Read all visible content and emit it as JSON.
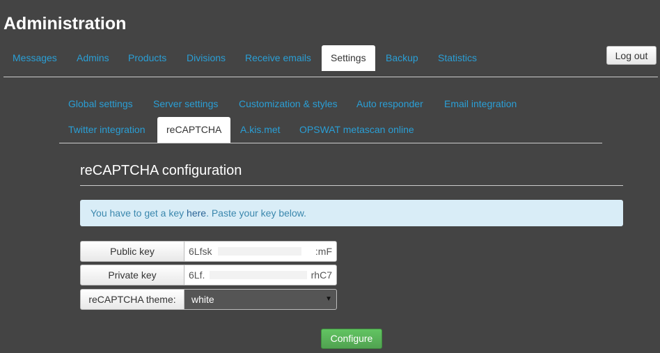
{
  "app": {
    "title": "Administration"
  },
  "main_nav": {
    "tabs": [
      {
        "label": "Messages"
      },
      {
        "label": "Admins"
      },
      {
        "label": "Products"
      },
      {
        "label": "Divisions"
      },
      {
        "label": "Receive emails"
      },
      {
        "label": "Settings",
        "active": true
      },
      {
        "label": "Backup"
      },
      {
        "label": "Statistics"
      }
    ],
    "logout_label": "Log out"
  },
  "settings_nav": {
    "tabs": [
      {
        "label": "Global settings"
      },
      {
        "label": "Server settings"
      },
      {
        "label": "Customization & styles"
      },
      {
        "label": "Auto responder"
      },
      {
        "label": "Email integration"
      },
      {
        "label": "Twitter integration"
      },
      {
        "label": "reCAPTCHA",
        "active": true
      },
      {
        "label": "A.kis.met"
      },
      {
        "label": "OPSWAT metascan online"
      }
    ]
  },
  "section": {
    "title": "reCAPTCHA configuration"
  },
  "info": {
    "prefix": "You have to get a key ",
    "link": "here",
    "suffix": ". Paste your key below."
  },
  "form": {
    "public_key": {
      "label": "Public key",
      "value_start": "6Lfsk",
      "value_end": ":mF"
    },
    "private_key": {
      "label": "Private key",
      "value_start": "6Lf.",
      "value_end": "rhC7"
    },
    "theme": {
      "label": "reCAPTCHA theme:",
      "selected": "white"
    }
  },
  "actions": {
    "configure_label": "Configure"
  },
  "colors": {
    "background": "#444444",
    "link": "#2a9fd6",
    "info_bg": "#d9edf7",
    "info_text": "#3a87ad",
    "success": "#5cb85c"
  }
}
